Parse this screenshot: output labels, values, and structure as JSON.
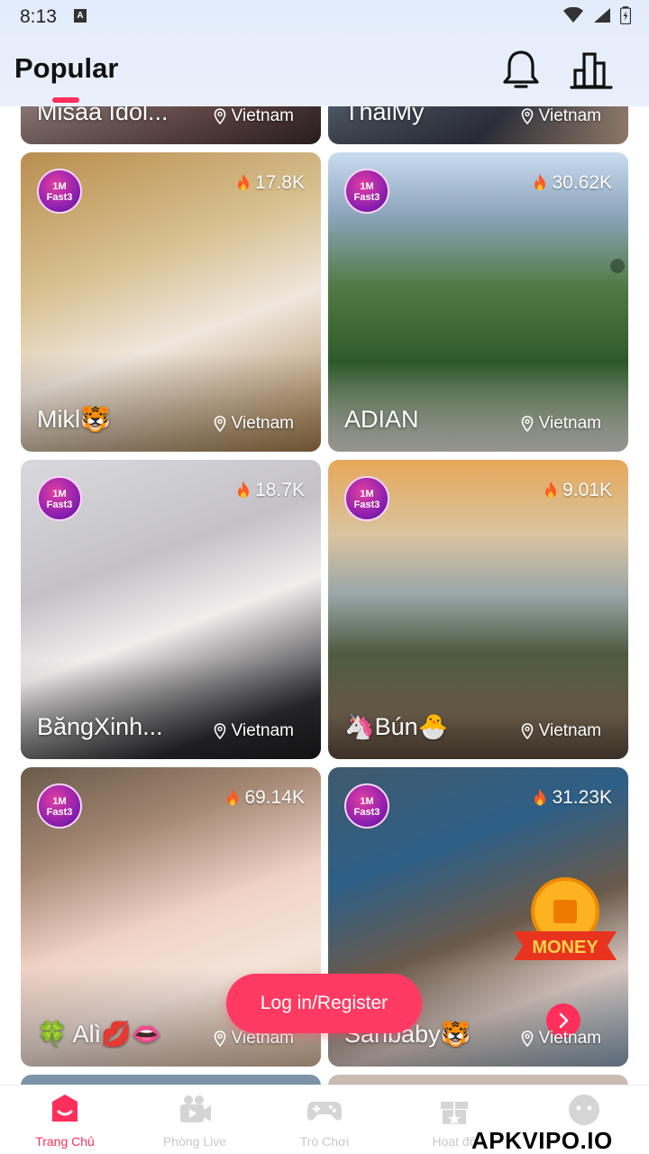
{
  "status_bar": {
    "time": "8:13",
    "notification_icon": "A"
  },
  "header": {
    "title": "Popular",
    "bell_icon": "bell-icon",
    "ranking_icon": "ranking-icon"
  },
  "partial_cards": [
    {
      "name": "Misaa Idol...",
      "location": "Vietnam"
    },
    {
      "name": "ThaiMy",
      "location": "Vietnam"
    }
  ],
  "cards": [
    {
      "badge_top": "1M",
      "badge_bottom": "Fast3",
      "views": "17.8K",
      "name": "Mikl🐯",
      "location": "Vietnam"
    },
    {
      "badge_top": "1M",
      "badge_bottom": "Fast3",
      "views": "30.62K",
      "name": "ADIAN",
      "location": "Vietnam"
    },
    {
      "badge_top": "1M",
      "badge_bottom": "Fast3",
      "views": "18.7K",
      "name": "BăngXinh...",
      "location": "Vietnam"
    },
    {
      "badge_top": "1M",
      "badge_bottom": "Fast3",
      "views": "9.01K",
      "name": "🦄Bún🐣",
      "location": "Vietnam"
    },
    {
      "badge_top": "1M",
      "badge_bottom": "Fast3",
      "views": "69.14K",
      "name": "🍀 Alì💋👄",
      "location": "Vietnam"
    },
    {
      "badge_top": "1M",
      "badge_bottom": "Fast3",
      "views": "31.23K",
      "name": "Sanbaby🐯",
      "location": "Vietnam"
    }
  ],
  "promo": {
    "money_label": "MONEY"
  },
  "login_button": "Log in/Register",
  "bottom_nav": [
    {
      "label": "Trang Chủ",
      "icon": "home-icon",
      "active": true
    },
    {
      "label": "Phòng Live",
      "icon": "live-room-icon",
      "active": false
    },
    {
      "label": "Trò Chơi",
      "icon": "gamepad-icon",
      "active": false
    },
    {
      "label": "Hoạt độ",
      "icon": "gift-icon",
      "active": false
    },
    {
      "label": "",
      "icon": "profile-icon",
      "active": false
    }
  ],
  "watermark": "APKVIPO.IO",
  "colors": {
    "accent": "#ff2f5b",
    "header_bg": "#e3ecfb",
    "nav_inactive": "#c8c8c8"
  }
}
